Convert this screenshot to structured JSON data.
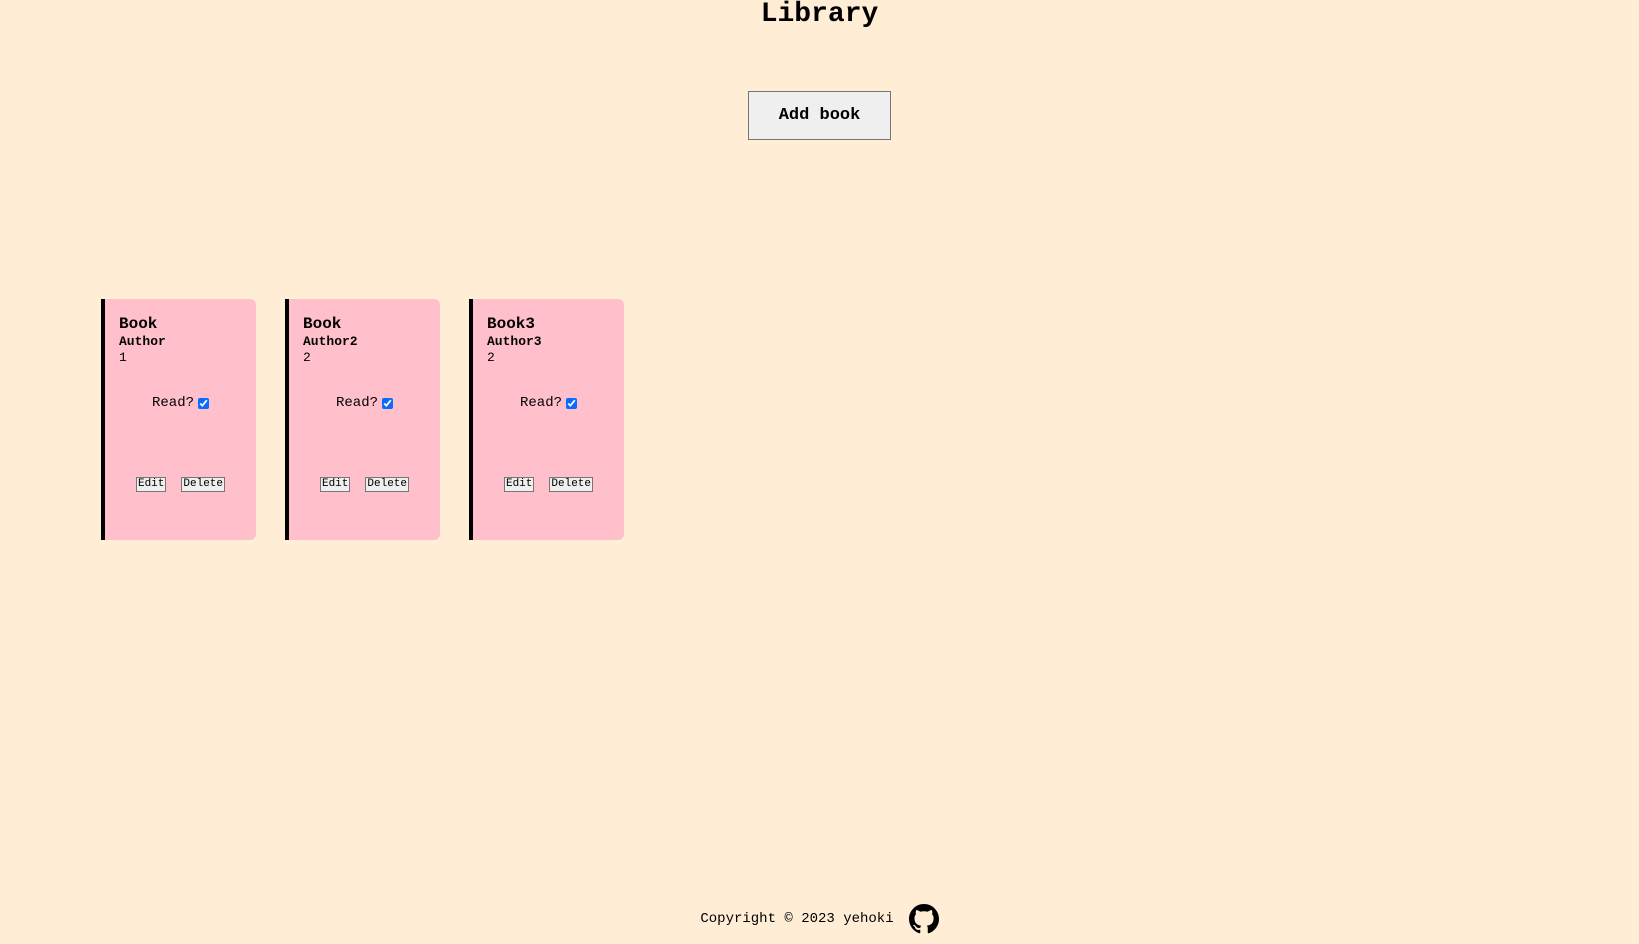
{
  "header": {
    "title": "Library",
    "add_book_label": "Add book"
  },
  "books": [
    {
      "title": "Book",
      "author": "Author",
      "pages": "1",
      "read_label": "Read?",
      "read": true,
      "edit_label": "Edit",
      "delete_label": "Delete"
    },
    {
      "title": "Book",
      "author": "Author2",
      "pages": "2",
      "read_label": "Read?",
      "read": true,
      "edit_label": "Edit",
      "delete_label": "Delete"
    },
    {
      "title": "Book3",
      "author": "Author3",
      "pages": "2",
      "read_label": "Read?",
      "read": true,
      "edit_label": "Edit",
      "delete_label": "Delete"
    }
  ],
  "footer": {
    "copyright": "Copyright © 2023 yehoki",
    "github_icon": "github-icon"
  },
  "colors": {
    "background": "#ffedd5",
    "card": "#ffc0cb",
    "card_border": "#000000",
    "checkbox": "#0b6bff"
  }
}
